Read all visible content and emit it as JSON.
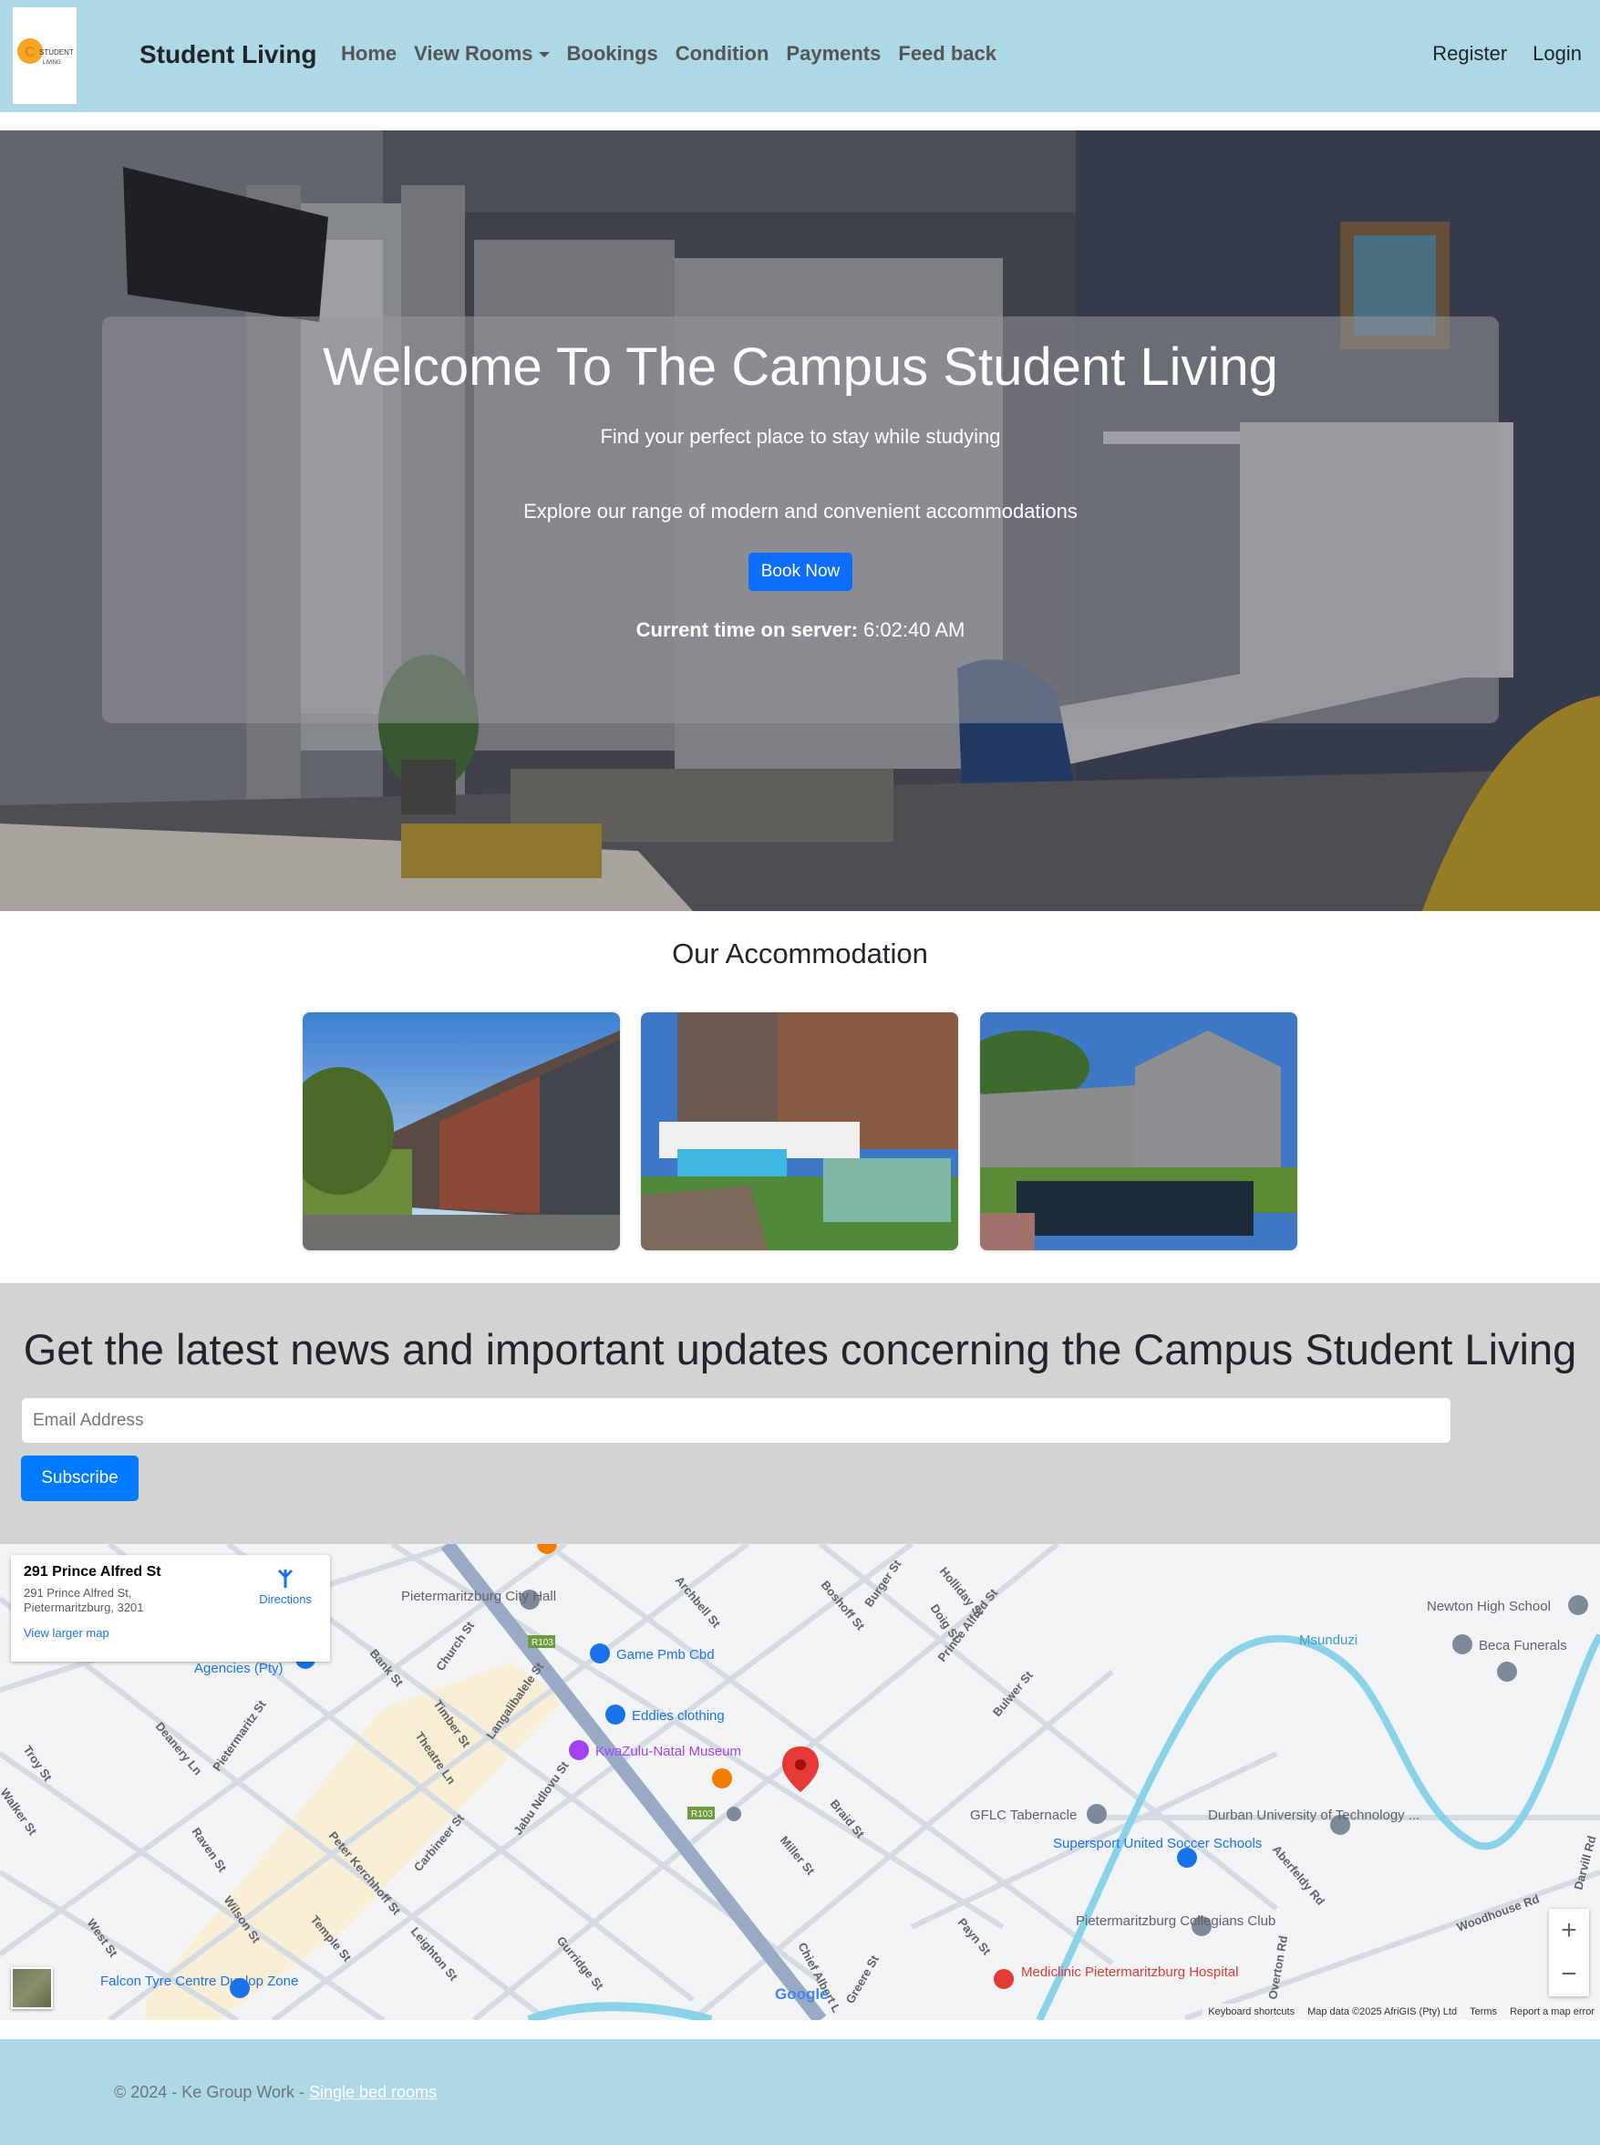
{
  "navbar": {
    "logo_text": "STUDENT LIVING",
    "brand": "Student Living",
    "links": [
      "Home",
      "View Rooms",
      "Bookings",
      "Condition",
      "Payments",
      "Feed back"
    ],
    "right": [
      "Register",
      "Login"
    ]
  },
  "hero": {
    "title": "Welcome To The Campus Student Living",
    "subtitle": "Find your perfect place to stay while studying",
    "subtitle2": "Explore our range of modern and convenient accommodations",
    "button": "Book Now",
    "time_label": "Current time on server:",
    "time_value": "6:02:40 AM"
  },
  "accommodation": {
    "title": "Our Accommodation"
  },
  "newsletter": {
    "title": "Get the latest news and important updates concerning the Campus Student Living",
    "email_placeholder": "Email Address",
    "button": "Subscribe"
  },
  "map": {
    "card_title": "291 Prince Alfred St",
    "card_address": "291 Prince Alfred St, Pietermaritzburg, 3201",
    "directions": "Directions",
    "larger_map": "View larger map",
    "footer": [
      "Keyboard shortcuts",
      "Map data ©2025 AfriGIS (Pty) Ltd",
      "Terms",
      "Report a map error"
    ],
    "zoom_in": "+",
    "zoom_out": "−",
    "labels": {
      "l1": "Pietermaritzburg City Hall",
      "l2": "Game Pmb Cbd",
      "l3": "Eddies clothing",
      "l4": "KwaZulu-Natal Museum",
      "l5": "GFLC Tabernacle",
      "l6": "Durban University of Technology ...",
      "l7": "Supersport United Soccer Schools",
      "l8": "Pietermaritzburg Collegians Club",
      "l9": "Mediclinic Pietermaritzburg Hospital",
      "l10": "Newton High School",
      "l11": "Beca Funerals",
      "l12": "Falcon Tyre Centre Dunlop Zone",
      "l13": "Agencies (Pty)",
      "l14": "Msunduzi",
      "s1": "Boshoff St",
      "s2": "Prince Alfred St",
      "s3": "Chief Albert L",
      "s4": "Church St",
      "s5": "Jabu Ndlovu St",
      "s6": "Woodhouse Rd",
      "s7": "Aberfeldy Rd",
      "s8": "Burger St",
      "s9": "Bulwer St",
      "s10": "Miller St",
      "s11": "Braid St",
      "s12": "Peter Kerchhoff St",
      "s13": "Langalibalele St",
      "s14": "Timber St",
      "s15": "Archbell St",
      "s16": "Holliday St",
      "s17": "Doig St",
      "s18": "West St",
      "s19": "Wilson St",
      "s20": "Raven St",
      "s21": "Deanery Ln",
      "s22": "Carbineer St",
      "s23": "Temple St",
      "s24": "Leighton St",
      "s25": "Payn St",
      "s26": "Darvill Rd",
      "s27": "Overton Rd",
      "s28": "Theatre Ln",
      "s29": "Troy St",
      "s30": "Bank St",
      "s31": "Pietermaritz St",
      "s32": "Walker St",
      "s33": "Gurridge St",
      "s34": "Greere St",
      "r1": "R103",
      "google": "Google"
    }
  },
  "footer": {
    "text": "© 2024 - Ke Group Work - ",
    "link": "Single bed rooms"
  }
}
